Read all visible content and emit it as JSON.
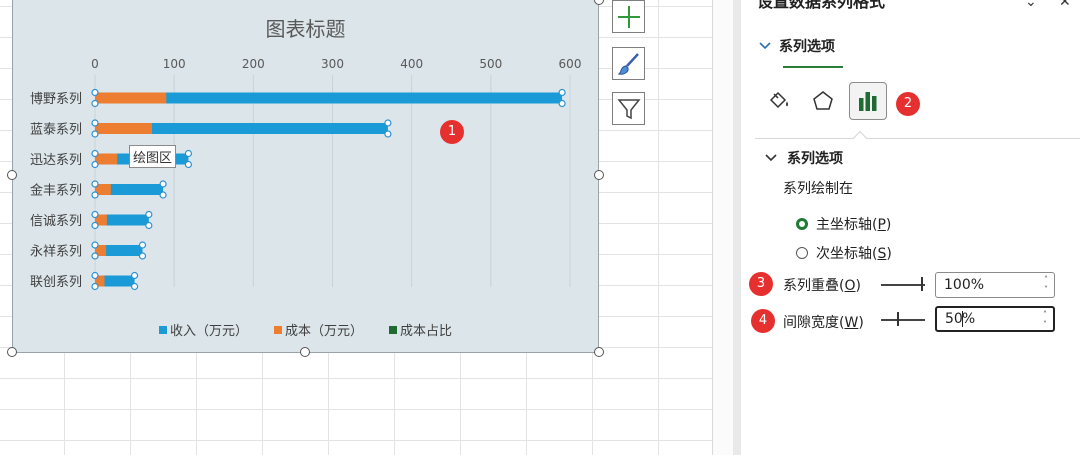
{
  "chart": {
    "title": "图表标题",
    "tooltip": "绘图区",
    "axis_ticks": [
      "0",
      "100",
      "200",
      "300",
      "400",
      "500",
      "600"
    ],
    "legend": [
      {
        "label": "收入（万元）",
        "color": "#1a9bd7"
      },
      {
        "label": "成本（万元）",
        "color": "#ed7d31"
      },
      {
        "label": "成本占比",
        "color": "#1e6b2f"
      }
    ]
  },
  "chart_data": {
    "type": "bar",
    "orientation": "horizontal",
    "stacked": false,
    "overlap": "100%",
    "categories": [
      "博野系列",
      "蓝泰系列",
      "迅达系列",
      "金丰系列",
      "信诚系列",
      "永祥系列",
      "联创系列"
    ],
    "series": [
      {
        "name": "收入（万元）",
        "color": "#1a9bd7",
        "values": [
          590,
          370,
          118,
          86,
          68,
          60,
          50
        ]
      },
      {
        "name": "成本（万元）",
        "color": "#ed7d31",
        "values": [
          90,
          72,
          28,
          20,
          15,
          14,
          12
        ]
      },
      {
        "name": "成本占比",
        "color": "#1e6b2f",
        "values": []
      }
    ],
    "xlim": [
      0,
      600
    ],
    "xticks": [
      0,
      100,
      200,
      300,
      400,
      500,
      600
    ],
    "grid": true,
    "legend_position": "bottom"
  },
  "badges": [
    "1",
    "2",
    "3",
    "4"
  ],
  "pane": {
    "title": "设置数据系列格式",
    "tab_label": "系列选项",
    "section_label": "系列选项",
    "plot_on_label": "系列绘制在",
    "radio_primary": {
      "text": "主坐标轴(",
      "key": "P",
      "end": ")"
    },
    "radio_secondary": {
      "text": "次坐标轴(",
      "key": "S",
      "end": ")"
    },
    "overlap": {
      "text": "系列重叠(",
      "key": "O",
      "end": ")",
      "value": "100%"
    },
    "gap": {
      "text": "间隙宽度(",
      "key": "W",
      "end": ")",
      "value_a": "50",
      "value_b": "%"
    }
  },
  "icons": {
    "add": "plus-icon",
    "style": "brush-icon",
    "filter": "funnel-icon",
    "fill": "paint-bucket-icon",
    "effects": "pentagon-icon",
    "series": "bar-chart-icon"
  }
}
